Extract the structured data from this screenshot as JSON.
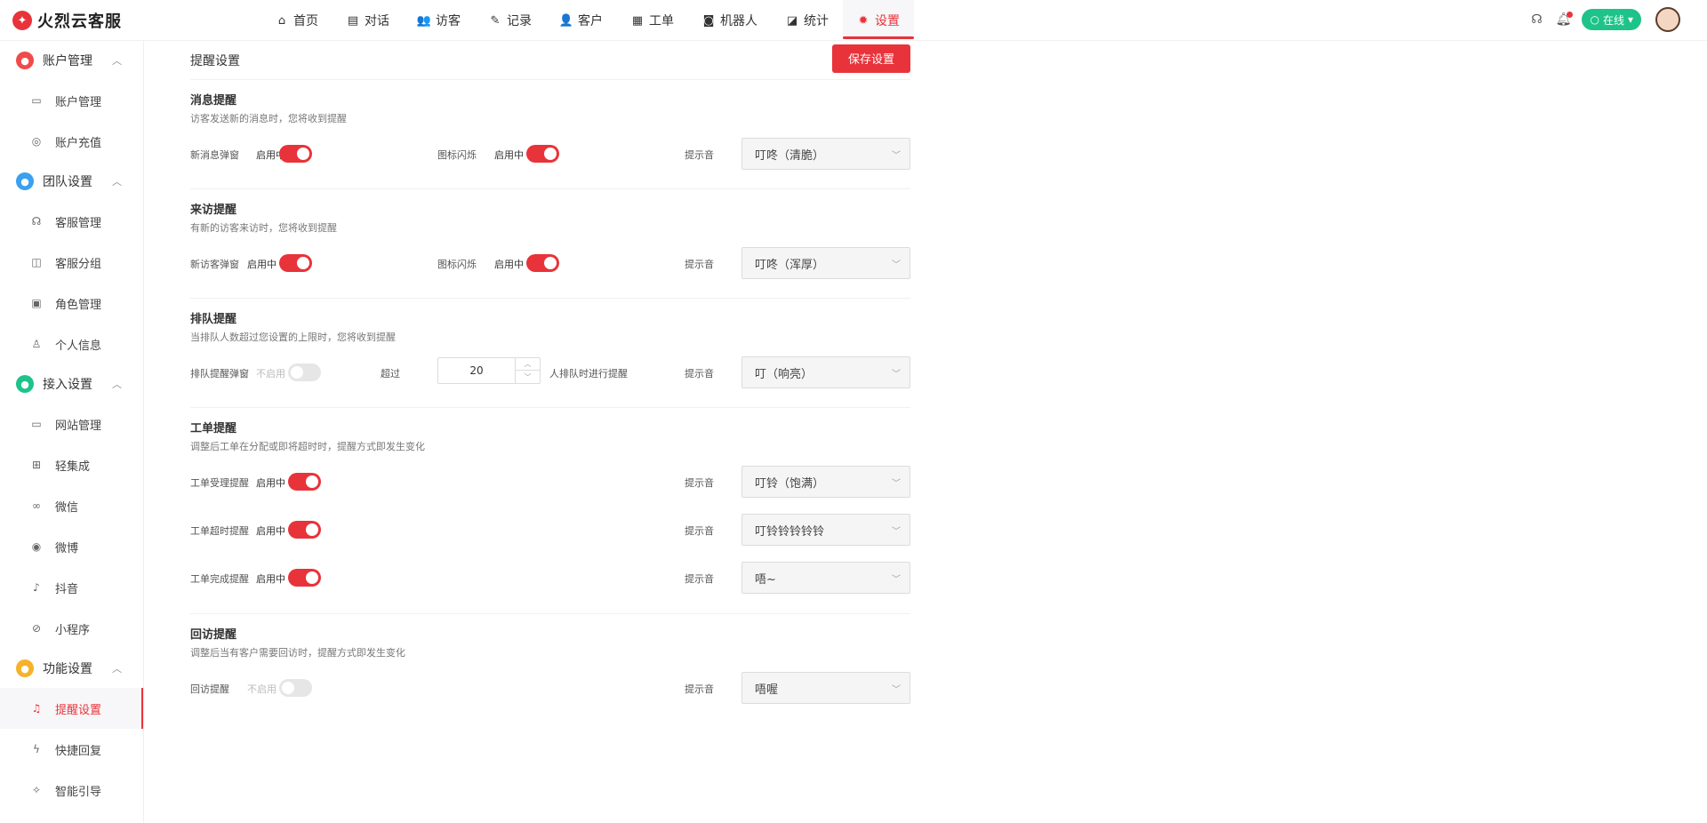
{
  "app": {
    "logo_text": "火烈云客服"
  },
  "nav": [
    {
      "label": "首页",
      "icon": "home-icon"
    },
    {
      "label": "对话",
      "icon": "chat-icon"
    },
    {
      "label": "访客",
      "icon": "visitor-icon"
    },
    {
      "label": "记录",
      "icon": "record-icon"
    },
    {
      "label": "客户",
      "icon": "customer-icon"
    },
    {
      "label": "工单",
      "icon": "ticket-icon"
    },
    {
      "label": "机器人",
      "icon": "robot-icon"
    },
    {
      "label": "统计",
      "icon": "stats-icon"
    },
    {
      "label": "设置",
      "icon": "settings-icon",
      "active": true
    }
  ],
  "topright": {
    "status": "在线"
  },
  "sidebar": {
    "groups": [
      {
        "title": "账户管理",
        "color": "#ef4b4b",
        "items": [
          {
            "label": "账户管理"
          },
          {
            "label": "账户充值"
          }
        ]
      },
      {
        "title": "团队设置",
        "color": "#3aa0f0",
        "items": [
          {
            "label": "客服管理"
          },
          {
            "label": "客服分组"
          },
          {
            "label": "角色管理"
          },
          {
            "label": "个人信息"
          }
        ]
      },
      {
        "title": "接入设置",
        "color": "#1ec38a",
        "items": [
          {
            "label": "网站管理"
          },
          {
            "label": "轻集成"
          },
          {
            "label": "微信"
          },
          {
            "label": "微博"
          },
          {
            "label": "抖音"
          },
          {
            "label": "小程序"
          }
        ]
      },
      {
        "title": "功能设置",
        "color": "#f6b22a",
        "items": [
          {
            "label": "提醒设置",
            "active": true
          },
          {
            "label": "快捷回复"
          },
          {
            "label": "智能引导"
          }
        ]
      }
    ]
  },
  "page": {
    "title": "提醒设置",
    "save_label": "保存设置"
  },
  "common": {
    "on": "启用中",
    "off": "不启用",
    "sound_label": "提示音",
    "icon_flash": "图标闪烁"
  },
  "sections": {
    "message": {
      "title": "消息提醒",
      "desc": "访客发送新的消息时，您将收到提醒",
      "popup_label": "新消息弹窗",
      "sound": "叮咚（清脆）"
    },
    "visit": {
      "title": "来访提醒",
      "desc": "有新的访客来访时，您将收到提醒",
      "popup_label": "新访客弹窗",
      "sound": "叮咚（浑厚）"
    },
    "queue": {
      "title": "排队提醒",
      "desc": "当排队人数超过您设置的上限时，您将收到提醒",
      "popup_label": "排队提醒弹窗",
      "exceed_label": "超过",
      "count": "20",
      "suffix": "人排队时进行提醒",
      "sound": "叮（响亮）"
    },
    "ticket": {
      "title": "工单提醒",
      "desc": "调整后工单在分配或即将超时时，提醒方式即发生变化",
      "rows": [
        {
          "label": "工单受理提醒",
          "sound": "叮铃（饱满）"
        },
        {
          "label": "工单超时提醒",
          "sound": "叮铃铃铃铃铃"
        },
        {
          "label": "工单完成提醒",
          "sound": "唔~"
        }
      ]
    },
    "revisit": {
      "title": "回访提醒",
      "desc": "调整后当有客户需要回访时，提醒方式即发生变化",
      "label": "回访提醒",
      "sound": "唔喔"
    }
  }
}
